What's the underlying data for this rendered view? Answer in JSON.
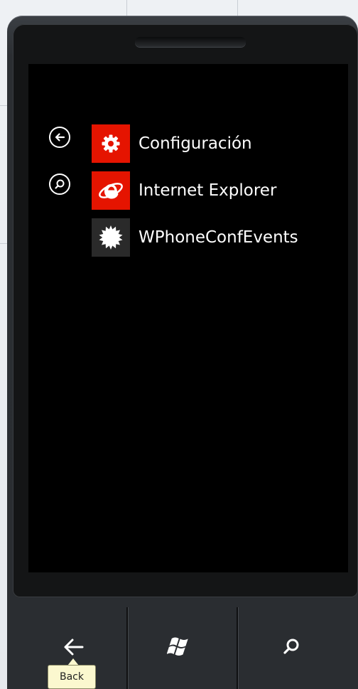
{
  "colors": {
    "screen_bg": "#000000",
    "accent_red": "#e51400",
    "tile_dark": "#2a2a2a",
    "phone_body": "#2a2d31",
    "tooltip_bg": "#fbf8cf"
  },
  "sidebar": {
    "back_icon": "arrow-left-circle-icon",
    "search_icon": "search-circle-icon"
  },
  "app_list": [
    {
      "label": "Configuración",
      "icon": "gear-icon",
      "tile_color": "#e51400"
    },
    {
      "label": "Internet Explorer",
      "icon": "internet-explorer-icon",
      "tile_color": "#e51400"
    },
    {
      "label": "WPhoneConfEvents",
      "icon": "starburst-icon",
      "tile_color": "#2a2a2a"
    }
  ],
  "hardware_buttons": {
    "back_icon": "back-arrow-icon",
    "start_icon": "windows-logo-icon",
    "search_icon": "search-icon"
  },
  "tooltip": {
    "text": "Back"
  }
}
